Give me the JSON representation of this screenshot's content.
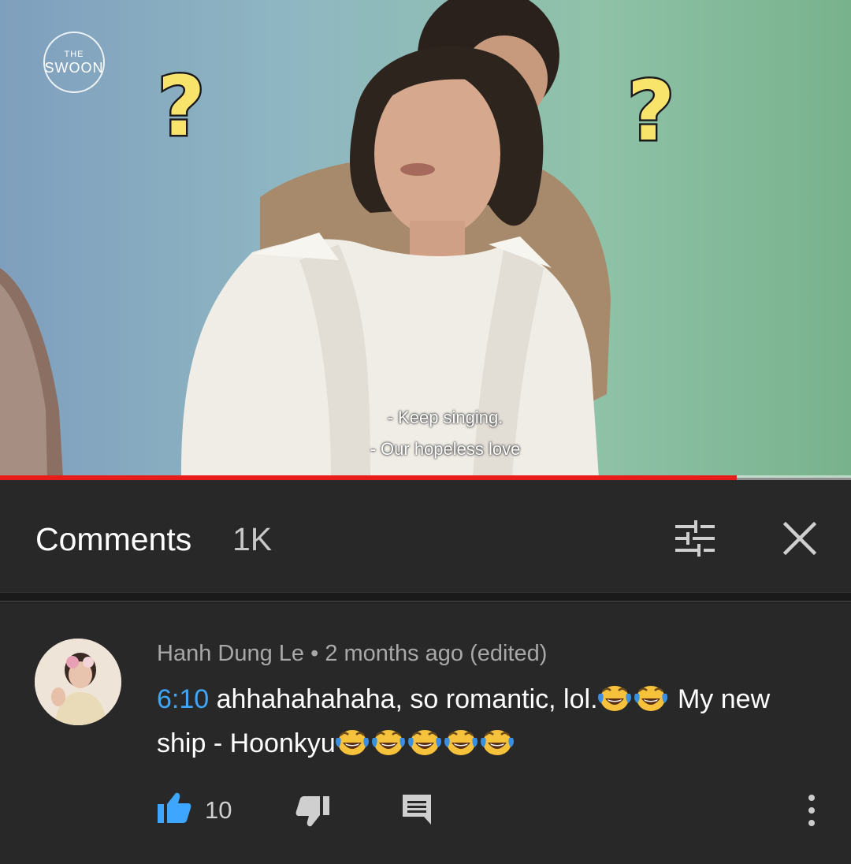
{
  "video": {
    "logo_top": "THE",
    "logo_bottom": "SWOON",
    "question_mark": "?",
    "subtitle_line1": "- Keep singing.",
    "subtitle_line2": "- Our hopeless love",
    "progress_fraction": 0.866
  },
  "comments_header": {
    "title": "Comments",
    "count": "1K",
    "filter_icon": "sort-filter-icon",
    "close_icon": "close-icon"
  },
  "comment": {
    "author": "Hanh Dung Le",
    "separator": " • ",
    "time": "2 months ago (edited)",
    "timestamp": "6:10",
    "text_part1": " ahhahahahaha,  so romantic, lol.",
    "text_part2": " My new ship - Hoonkyu",
    "emoji_name": "face-with-tears-of-joy",
    "like_count": "10",
    "like_icon": "thumbs-up-icon",
    "dislike_icon": "thumbs-down-icon",
    "reply_icon": "reply-comment-icon",
    "more_icon": "more-vertical-icon"
  },
  "colors": {
    "accent_link": "#3ea6ff",
    "progress": "#e91c1c",
    "background": "#282828"
  }
}
